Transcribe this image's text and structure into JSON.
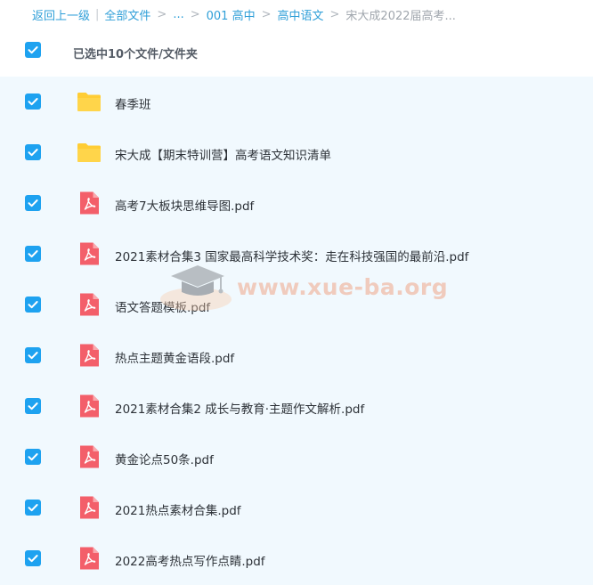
{
  "breadcrumb": {
    "back": "返回上一级",
    "all_files": "全部文件",
    "ellipsis": "...",
    "level1": "001 高中",
    "level2": "高中语文",
    "current": "宋大成2022届高考..."
  },
  "header": {
    "selected_text": "已选中10个文件/文件夹"
  },
  "watermark": {
    "text": "www.xue-ba.org"
  },
  "files": [
    {
      "name": "春季班",
      "icon": "folder-icon"
    },
    {
      "name": "宋大成【期末特训营】高考语文知识清单",
      "icon": "folder-icon"
    },
    {
      "name": "高考7大板块思维导图.pdf",
      "icon": "pdf-icon"
    },
    {
      "name": "2021素材合集3 国家最高科学技术奖：走在科技强国的最前沿.pdf",
      "icon": "pdf-icon"
    },
    {
      "name": "语文答题模板.pdf",
      "icon": "pdf-icon"
    },
    {
      "name": "热点主题黄金语段.pdf",
      "icon": "pdf-icon"
    },
    {
      "name": "2021素材合集2 成长与教育·主题作文解析.pdf",
      "icon": "pdf-icon"
    },
    {
      "name": "黄金论点50条.pdf",
      "icon": "pdf-icon"
    },
    {
      "name": "2021热点素材合集.pdf",
      "icon": "pdf-icon"
    },
    {
      "name": "2022高考热点写作点睛.pdf",
      "icon": "pdf-icon"
    }
  ],
  "colors": {
    "accent": "#1ea2f0",
    "link": "#2f9fd8",
    "folder": "#ffcd35",
    "pdf": "#f35f6a",
    "list_bg": "#f1f9fe"
  }
}
